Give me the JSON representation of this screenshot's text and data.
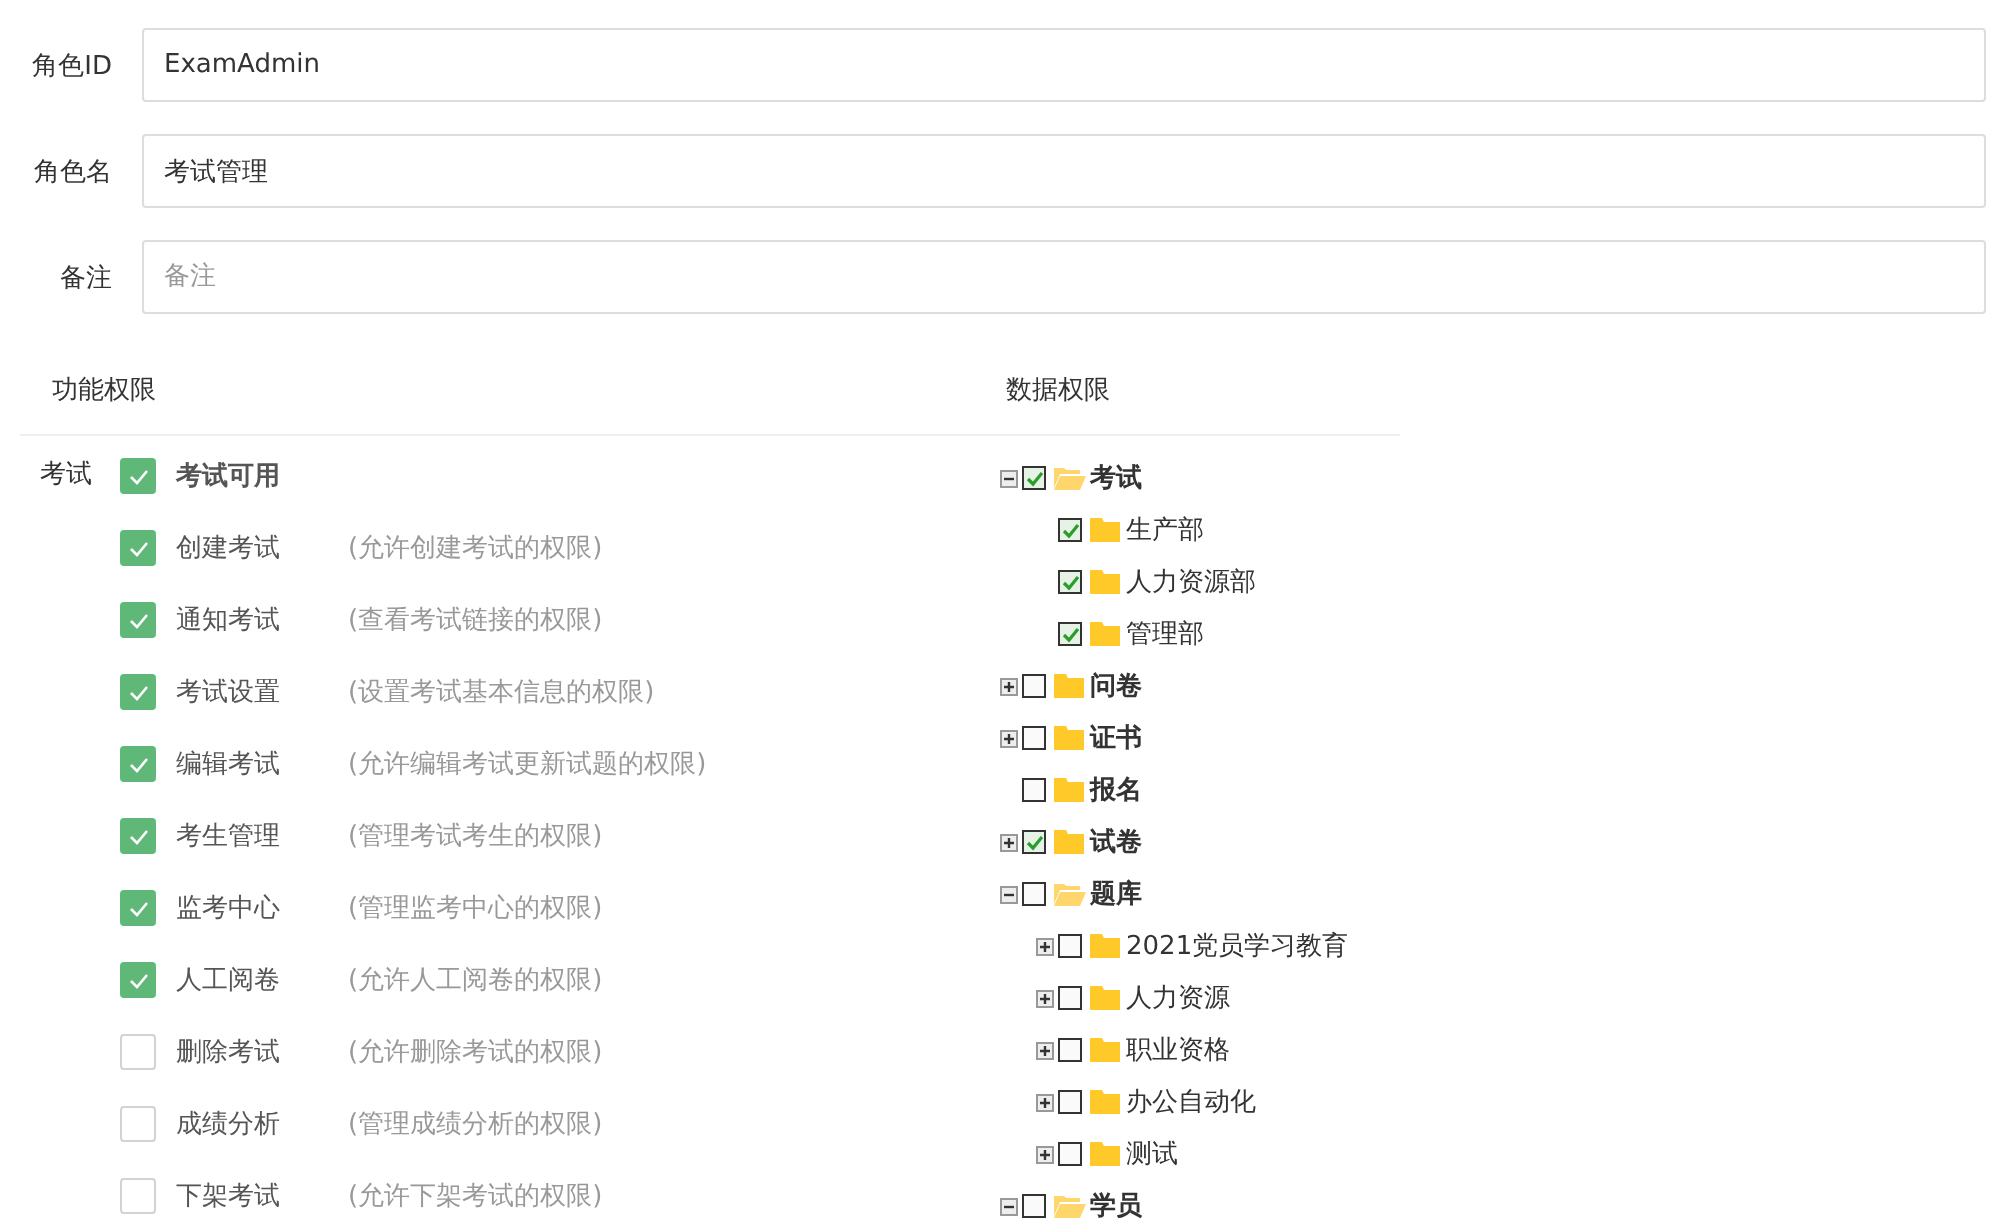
{
  "form": [
    {
      "label": "角色ID",
      "value": "ExamAdmin"
    },
    {
      "label": "角色名",
      "value": "考试管理"
    },
    {
      "label": "备注",
      "placeholder": "备注"
    }
  ],
  "function_permissions": {
    "title": "功能权限",
    "group": "考试",
    "items": [
      {
        "name": "考试可用",
        "checked": true,
        "kind": "master"
      },
      {
        "name": "创建考试",
        "hint": "(允许创建考试的权限)",
        "checked": true,
        "kind": "item"
      },
      {
        "name": "通知考试",
        "hint": "(查看考试链接的权限)",
        "checked": true,
        "kind": "item"
      },
      {
        "name": "考试设置",
        "hint": "(设置考试基本信息的权限)",
        "checked": true,
        "kind": "item"
      },
      {
        "name": "编辑考试",
        "hint": "(允许编辑考试更新试题的权限)",
        "checked": true,
        "kind": "item"
      },
      {
        "name": "考生管理",
        "hint": "(管理考试考生的权限)",
        "checked": true,
        "kind": "item"
      },
      {
        "name": "监考中心",
        "hint": "(管理监考中心的权限)",
        "checked": true,
        "kind": "item"
      },
      {
        "name": "人工阅卷",
        "hint": "(允许人工阅卷的权限)",
        "checked": true,
        "kind": "item"
      },
      {
        "name": "删除考试",
        "hint": "(允许删除考试的权限)",
        "checked": false,
        "kind": "item"
      },
      {
        "name": "成绩分析",
        "hint": "(管理成绩分析的权限)",
        "checked": false,
        "kind": "item"
      },
      {
        "name": "下架考试",
        "hint": "(允许下架考试的权限)",
        "checked": false,
        "kind": "item"
      }
    ]
  },
  "data_permissions": {
    "title": "数据权限",
    "tree": [
      {
        "label": "考试",
        "kind": "branch",
        "expanded": true,
        "checked": true,
        "children": [
          {
            "label": "生产部",
            "kind": "leaf",
            "checked": true
          },
          {
            "label": "人力资源部",
            "kind": "leaf",
            "checked": true
          },
          {
            "label": "管理部",
            "kind": "leaf",
            "checked": true
          }
        ]
      },
      {
        "label": "问卷",
        "kind": "branch",
        "expanded": false,
        "checked": false
      },
      {
        "label": "证书",
        "kind": "branch",
        "expanded": false,
        "checked": false
      },
      {
        "label": "报名",
        "kind": "leaf",
        "checked": false
      },
      {
        "label": "试卷",
        "kind": "branch",
        "expanded": false,
        "checked": true
      },
      {
        "label": "题库",
        "kind": "branch",
        "expanded": true,
        "checked": false,
        "children": [
          {
            "label": "2021党员学习教育",
            "kind": "branch",
            "expanded": false,
            "checked": false
          },
          {
            "label": "人力资源",
            "kind": "branch",
            "expanded": false,
            "checked": false
          },
          {
            "label": "职业资格",
            "kind": "branch",
            "expanded": false,
            "checked": false
          },
          {
            "label": "办公自动化",
            "kind": "branch",
            "expanded": false,
            "checked": false
          },
          {
            "label": "测试",
            "kind": "branch",
            "expanded": false,
            "checked": false
          }
        ]
      },
      {
        "label": "学员",
        "kind": "branch",
        "expanded": true,
        "checked": false
      }
    ]
  }
}
